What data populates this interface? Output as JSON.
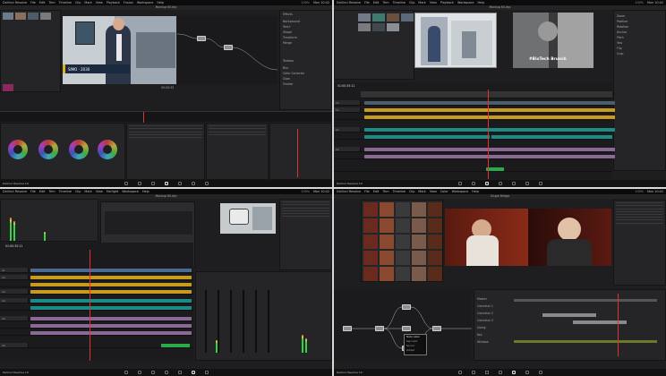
{
  "menu_items": [
    "DaVinci Resolve",
    "File",
    "Edit",
    "Trim",
    "Timeline",
    "Clip",
    "Mark",
    "View",
    "Playback",
    "Fusion",
    "Color",
    "Fairlight",
    "Workspace",
    "Help"
  ],
  "status_items": [
    "100%",
    "Mon 10:42"
  ],
  "brand": "DaVinci Resolve 19",
  "pages": [
    "Media",
    "Cut",
    "Edit",
    "Fusion",
    "Color",
    "Fairlight",
    "Deliver"
  ],
  "panels": {
    "fusion": {
      "window_title": "Mockup 60.drp",
      "lower_third_text": "SIMO · 2030",
      "timecode": "00:00:35",
      "inspector_headers": [
        "Effects",
        "Toolbox"
      ],
      "effect_items": [
        "Background",
        "Text+",
        "Shape",
        "Transform",
        "Merge",
        "Blur",
        "Color Corrector",
        "Glow",
        "Tracker"
      ]
    },
    "edit": {
      "window_title": "Mockup 60.drp",
      "viewer_caption": "#BioTech Brunch",
      "timecode": "01:00:35:11",
      "track_labels": [
        "V3",
        "V2",
        "V1",
        "A1",
        "A2",
        "A3",
        "A4",
        "A5"
      ],
      "inspector_items": [
        "Zoom",
        "Position",
        "Rotation",
        "Anchor",
        "Pitch",
        "Yaw",
        "Flip",
        "Crop"
      ]
    },
    "fairlight": {
      "window_title": "Mockup 60.drp",
      "timecode": "01:00:35:11",
      "track_labels": [
        "A1",
        "A2",
        "A3",
        "A4",
        "A5",
        "A6",
        "A7",
        "A8",
        "A9"
      ],
      "section_labels": [
        "Mixer",
        "Meters"
      ]
    },
    "color": {
      "window_title": "Single Bridge",
      "node_labels": [
        "01",
        "02",
        "03",
        "04",
        "05",
        "06"
      ],
      "tooltip_lines": [
        "Node Label",
        "Key Input",
        "Source",
        "Output"
      ],
      "keyframe_labels": [
        "Master",
        "Corrector 1",
        "Corrector 2",
        "Corrector 3",
        "Sizing",
        "Key",
        "Window"
      ]
    }
  }
}
